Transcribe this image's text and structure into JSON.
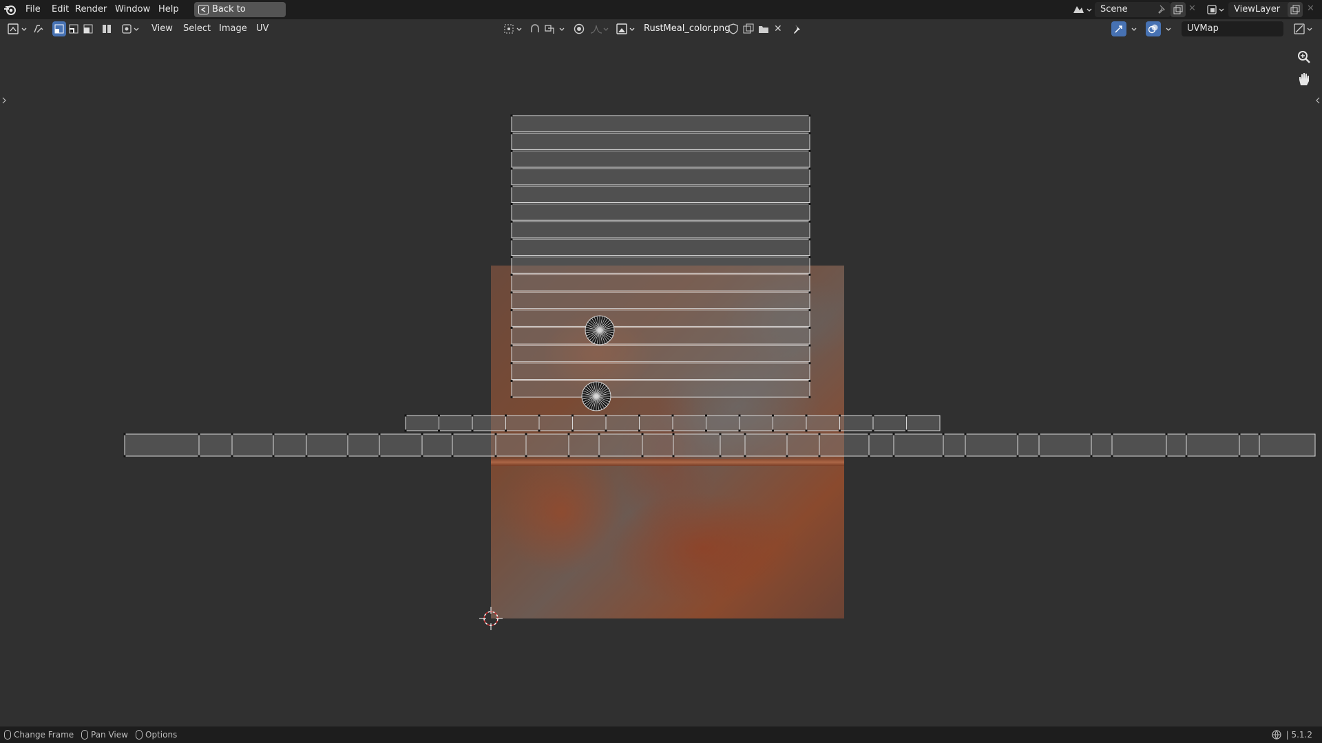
{
  "menubar": {
    "items": [
      "File",
      "Edit",
      "Render",
      "Window",
      "Help"
    ],
    "back_button": "Back to Previous",
    "scene": "Scene",
    "view_layer": "ViewLayer"
  },
  "header": {
    "menus": [
      "View",
      "Select",
      "Image",
      "UV"
    ],
    "image_name": "RustMeal_color.png",
    "uv_map": "UVMap"
  },
  "statusbar": {
    "items": [
      "Change Frame",
      "Pan View",
      "Options"
    ],
    "version": "5.1.2"
  },
  "colors": {
    "background": "#303030",
    "bar": "#1d1d1d",
    "uv_edge": "#d8d8d8",
    "rust": "#8a4a2e"
  },
  "icons": [
    "blender-logo",
    "editor-type-icon",
    "sync-icon",
    "select-mode-icons",
    "snap-icon",
    "proportional-icon",
    "pin-icon",
    "overlay-icon",
    "zoom-icon",
    "hand-icon",
    "cursor-icon"
  ]
}
